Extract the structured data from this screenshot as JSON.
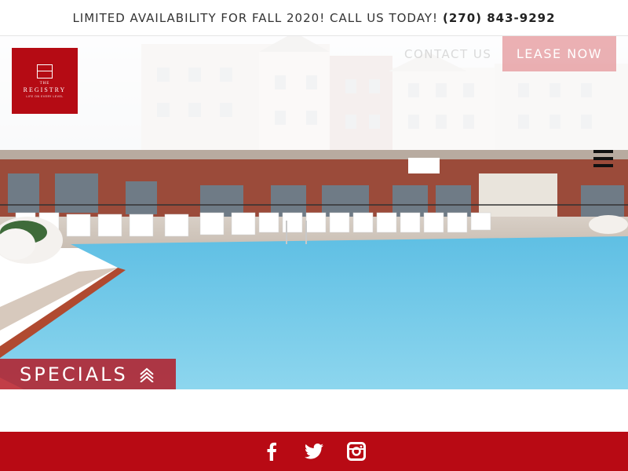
{
  "announcement": {
    "message": "LIMITED AVAILABILITY FOR FALL 2020! CALL US TODAY!",
    "phone": "(270) 843-9292"
  },
  "logo": {
    "the": "THE",
    "name": "REGISTRY",
    "tagline": "LIFE ON EVERY LEVEL",
    "icon": "building-mark-icon"
  },
  "nav": {
    "contact_label": "CONTACT US",
    "lease_label": "LEASE NOW",
    "menu_icon": "hamburger-menu-icon"
  },
  "hero": {
    "specials_label": "SPECIALS",
    "specials_icon": "double-chevron-up-icon"
  },
  "footer": {
    "social": [
      "facebook-icon",
      "twitter-icon",
      "instagram-icon"
    ]
  },
  "colors": {
    "brand_red": "#b80a14",
    "lease_pink": "#e4969a",
    "pool_blue": "#6cc6e6"
  }
}
